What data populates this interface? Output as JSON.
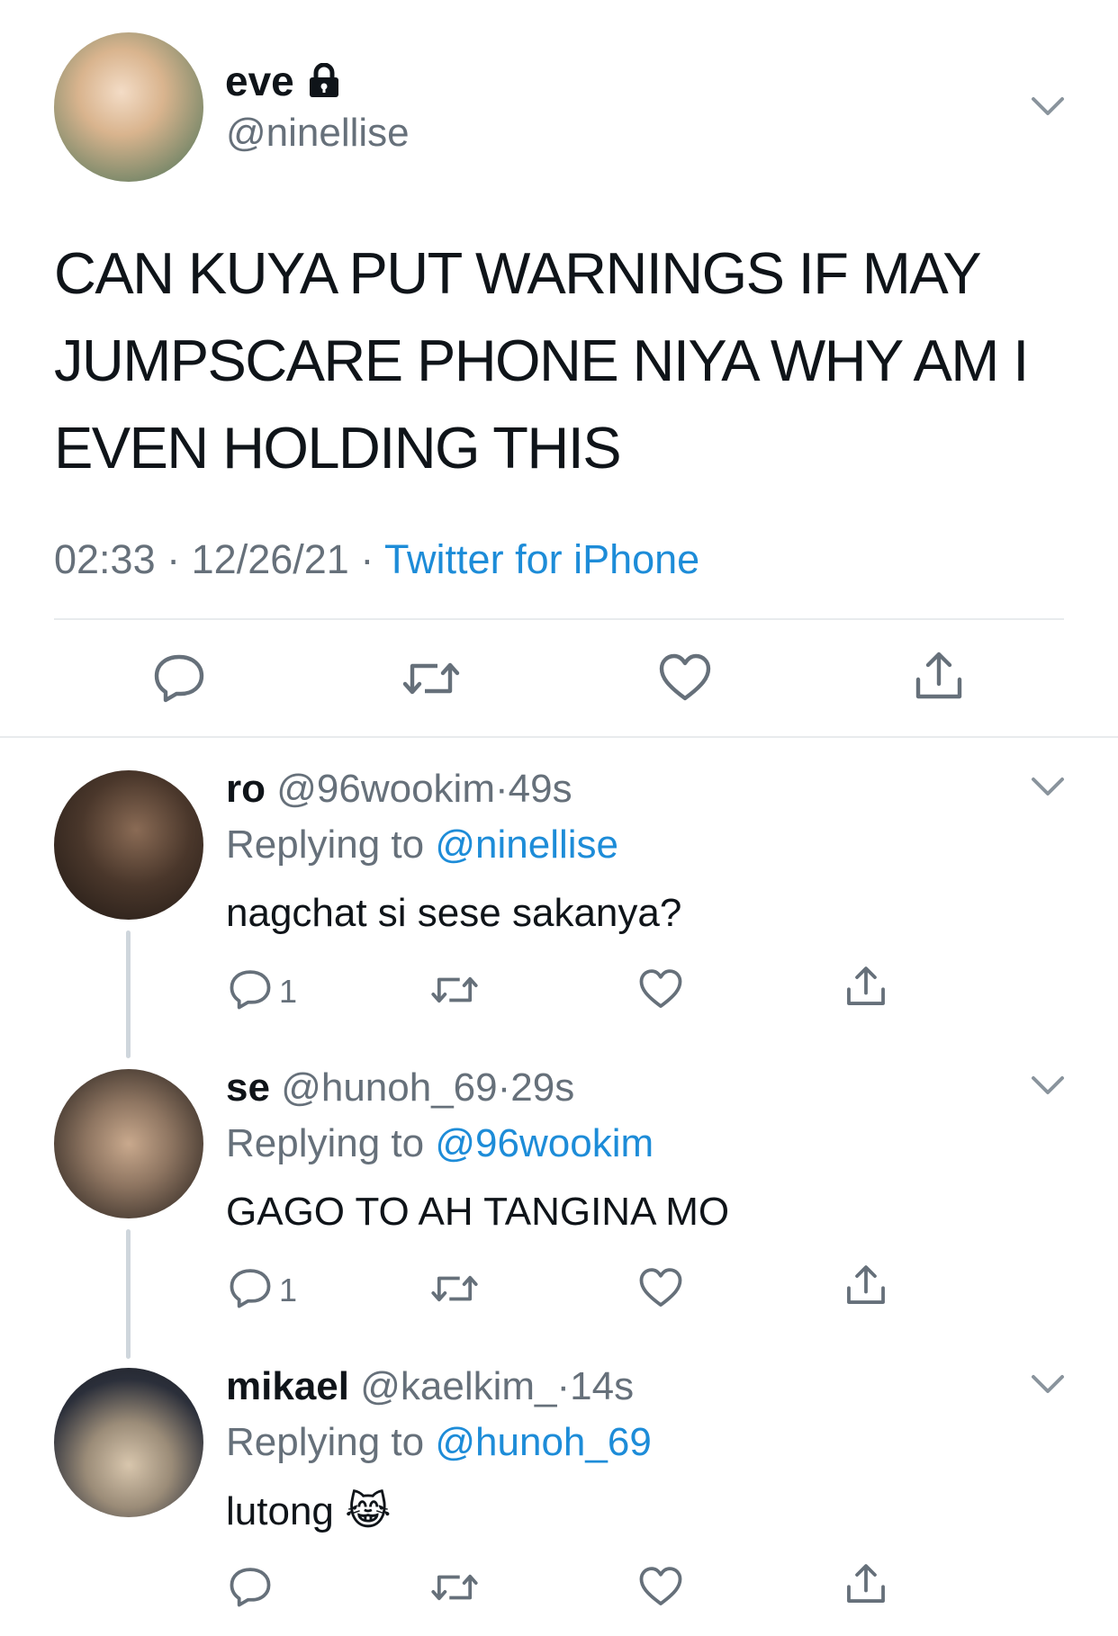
{
  "main_tweet": {
    "display_name": "eve",
    "handle": "@ninellise",
    "text_lines": [
      "CAN KUYA PUT WARNINGS IF MAY",
      "JUMPSCARE PHONE NIYA WHY AM I",
      "EVEN HOLDING THIS"
    ],
    "time": "02:33",
    "dot1": "·",
    "date": "12/26/21",
    "dot2": "·",
    "source": "Twitter for iPhone"
  },
  "replies": [
    {
      "display_name": "ro",
      "handle": "@96wookim",
      "dot": "·",
      "age": "49s",
      "replying_prefix": "Replying to",
      "replying_to": "@ninellise",
      "text": "nagchat si sese sakanya?",
      "reply_count": "1"
    },
    {
      "display_name": "se",
      "handle": "@hunoh_69",
      "dot": "·",
      "age": "29s",
      "replying_prefix": "Replying to",
      "replying_to": "@96wookim",
      "text": "GAGO TO AH TANGINA MO",
      "reply_count": "1"
    },
    {
      "display_name": "mikael",
      "handle": "@kaelkim_",
      "dot": "·",
      "age": "14s",
      "replying_prefix": "Replying to",
      "replying_to": "@hunoh_69",
      "text": "lutong",
      "text_emoji": "😹",
      "reply_count": ""
    }
  ],
  "colors": {
    "accent": "#1d8cd8",
    "muted": "#66707a",
    "text": "#0f1419"
  },
  "icons": [
    "lock-icon",
    "chevron-down-icon",
    "reply-icon",
    "retweet-icon",
    "like-icon",
    "share-icon"
  ]
}
